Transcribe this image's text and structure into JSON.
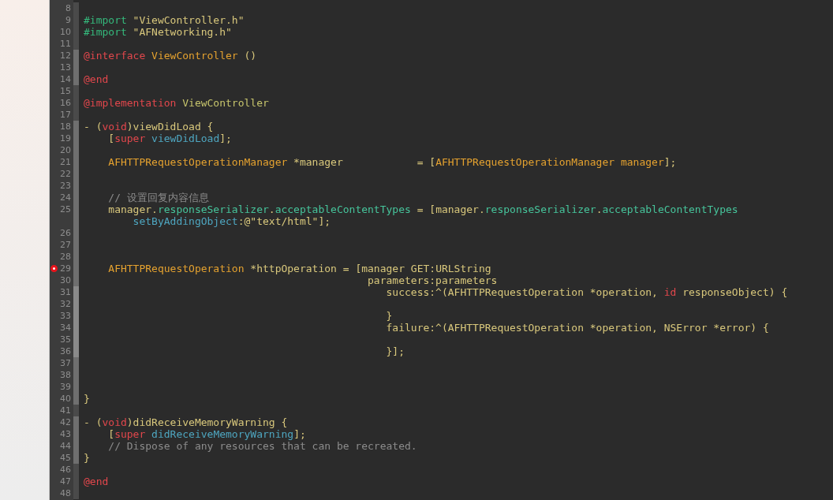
{
  "editor": {
    "lines": [
      {
        "number": "8",
        "in_block": false,
        "nested": false,
        "breakpoint": false
      },
      {
        "number": "9",
        "in_block": false,
        "nested": false,
        "breakpoint": false,
        "tokens": [
          {
            "kind": "directive",
            "text": "#import"
          },
          {
            "kind": "plain",
            "text": " \"ViewController.h\""
          }
        ]
      },
      {
        "number": "10",
        "in_block": false,
        "nested": false,
        "breakpoint": false,
        "tokens": [
          {
            "kind": "directive",
            "text": "#import"
          },
          {
            "kind": "plain",
            "text": " \"AFNetworking.h\""
          }
        ]
      },
      {
        "number": "11",
        "in_block": false,
        "nested": false,
        "breakpoint": false
      },
      {
        "number": "12",
        "in_block": true,
        "nested": false,
        "breakpoint": false,
        "tokens": [
          {
            "kind": "keyword",
            "text": "@interface "
          },
          {
            "kind": "type",
            "text": "ViewController"
          },
          {
            "kind": "plain",
            "text": " ()"
          }
        ]
      },
      {
        "number": "13",
        "in_block": true,
        "nested": false,
        "breakpoint": false
      },
      {
        "number": "14",
        "in_block": true,
        "nested": false,
        "breakpoint": false,
        "tokens": [
          {
            "kind": "keyword",
            "text": "@end"
          }
        ]
      },
      {
        "number": "15",
        "in_block": false,
        "nested": false,
        "breakpoint": false
      },
      {
        "number": "16",
        "in_block": false,
        "nested": false,
        "breakpoint": false,
        "tokens": [
          {
            "kind": "keyword",
            "text": "@implementation "
          },
          {
            "kind": "name",
            "text": "ViewController"
          }
        ]
      },
      {
        "number": "17",
        "in_block": false,
        "nested": false,
        "breakpoint": false
      },
      {
        "number": "18",
        "in_block": true,
        "nested": false,
        "breakpoint": false,
        "tokens": [
          {
            "kind": "plain",
            "text": "- ("
          },
          {
            "kind": "keyword",
            "text": "void"
          },
          {
            "kind": "plain",
            "text": ")viewDidLoad {"
          }
        ]
      },
      {
        "number": "19",
        "in_block": true,
        "nested": false,
        "breakpoint": false,
        "tokens": [
          {
            "kind": "plain",
            "text": "    ["
          },
          {
            "kind": "keyword",
            "text": "super "
          },
          {
            "kind": "method",
            "text": "viewDidLoad"
          },
          {
            "kind": "plain",
            "text": "];"
          }
        ]
      },
      {
        "number": "20",
        "in_block": true,
        "nested": false,
        "breakpoint": false
      },
      {
        "number": "21",
        "in_block": true,
        "nested": false,
        "breakpoint": false,
        "tokens": [
          {
            "kind": "type",
            "text": "    AFHTTPRequestOperationManager"
          },
          {
            "kind": "plain",
            "text": " *manager            = ["
          },
          {
            "kind": "type",
            "text": "AFHTTPRequestOperationManager manager"
          },
          {
            "kind": "plain",
            "text": "];"
          }
        ]
      },
      {
        "number": "22",
        "in_block": true,
        "nested": false,
        "breakpoint": false
      },
      {
        "number": "23",
        "in_block": true,
        "nested": false,
        "breakpoint": false
      },
      {
        "number": "24",
        "in_block": true,
        "nested": false,
        "breakpoint": false,
        "tokens": [
          {
            "kind": "comment",
            "text": "    // 设置回复内容信息"
          }
        ]
      },
      {
        "number": "25",
        "in_block": true,
        "nested": false,
        "breakpoint": false,
        "tokens": [
          {
            "kind": "plain",
            "text": "    manager."
          },
          {
            "kind": "property",
            "text": "responseSerializer"
          },
          {
            "kind": "plain",
            "text": "."
          },
          {
            "kind": "property",
            "text": "acceptableContentTypes"
          },
          {
            "kind": "plain",
            "text": " = [manager."
          },
          {
            "kind": "property",
            "text": "responseSerializer"
          },
          {
            "kind": "plain",
            "text": "."
          },
          {
            "kind": "property",
            "text": "acceptableContentTypes"
          }
        ]
      },
      {
        "in_block": true,
        "nested": false,
        "breakpoint": false,
        "tokens": [
          {
            "kind": "method",
            "text": "        setByAddingObject"
          },
          {
            "kind": "plain",
            "text": ":@\"text/html\"];"
          }
        ]
      },
      {
        "number": "26",
        "in_block": true,
        "nested": false,
        "breakpoint": false
      },
      {
        "number": "27",
        "in_block": true,
        "nested": false,
        "breakpoint": false
      },
      {
        "number": "28",
        "in_block": true,
        "nested": false,
        "breakpoint": false
      },
      {
        "number": "29",
        "in_block": true,
        "nested": false,
        "breakpoint": true,
        "tokens": [
          {
            "kind": "type",
            "text": "    AFHTTPRequestOperation"
          },
          {
            "kind": "plain",
            "text": " *httpOperation = [manager GET:URLString"
          }
        ]
      },
      {
        "number": "30",
        "in_block": true,
        "nested": false,
        "breakpoint": false,
        "tokens": [
          {
            "kind": "plain",
            "text": "                                              parameters:parameters"
          }
        ]
      },
      {
        "number": "31",
        "in_block": true,
        "nested": true,
        "breakpoint": false,
        "tokens": [
          {
            "kind": "plain",
            "text": "                                                 success:^(AFHTTPRequestOperation *operation, "
          },
          {
            "kind": "keyword",
            "text": "id"
          },
          {
            "kind": "plain",
            "text": " responseObject) {"
          }
        ]
      },
      {
        "number": "32",
        "in_block": true,
        "nested": true,
        "breakpoint": false
      },
      {
        "number": "33",
        "in_block": true,
        "nested": true,
        "breakpoint": false,
        "tokens": [
          {
            "kind": "plain",
            "text": "                                                 }"
          }
        ]
      },
      {
        "number": "34",
        "in_block": true,
        "nested": true,
        "breakpoint": false,
        "tokens": [
          {
            "kind": "plain",
            "text": "                                                 failure:^(AFHTTPRequestOperation *operation, NSError *error) {"
          }
        ]
      },
      {
        "number": "35",
        "in_block": true,
        "nested": true,
        "breakpoint": false
      },
      {
        "number": "36",
        "in_block": true,
        "nested": true,
        "breakpoint": false,
        "tokens": [
          {
            "kind": "plain",
            "text": "                                                 }];"
          }
        ]
      },
      {
        "number": "37",
        "in_block": true,
        "nested": false,
        "breakpoint": false
      },
      {
        "number": "38",
        "in_block": true,
        "nested": false,
        "breakpoint": false
      },
      {
        "number": "39",
        "in_block": true,
        "nested": false,
        "breakpoint": false
      },
      {
        "number": "40",
        "in_block": true,
        "nested": false,
        "breakpoint": false,
        "tokens": [
          {
            "kind": "plain",
            "text": "}"
          }
        ]
      },
      {
        "number": "41",
        "in_block": false,
        "nested": false,
        "breakpoint": false
      },
      {
        "number": "42",
        "in_block": true,
        "nested": false,
        "breakpoint": false,
        "tokens": [
          {
            "kind": "plain",
            "text": "- ("
          },
          {
            "kind": "keyword",
            "text": "void"
          },
          {
            "kind": "plain",
            "text": ")didReceiveMemoryWarning {"
          }
        ]
      },
      {
        "number": "43",
        "in_block": true,
        "nested": false,
        "breakpoint": false,
        "tokens": [
          {
            "kind": "plain",
            "text": "    ["
          },
          {
            "kind": "keyword",
            "text": "super "
          },
          {
            "kind": "method",
            "text": "didReceiveMemoryWarning"
          },
          {
            "kind": "plain",
            "text": "];"
          }
        ]
      },
      {
        "number": "44",
        "in_block": true,
        "nested": false,
        "breakpoint": false,
        "tokens": [
          {
            "kind": "comment",
            "text": "    // Dispose of any resources that can be recreated."
          }
        ]
      },
      {
        "number": "45",
        "in_block": true,
        "nested": false,
        "breakpoint": false,
        "tokens": [
          {
            "kind": "plain",
            "text": "}"
          }
        ]
      },
      {
        "number": "46",
        "in_block": false,
        "nested": false,
        "breakpoint": false
      },
      {
        "number": "47",
        "in_block": false,
        "nested": false,
        "breakpoint": false,
        "tokens": [
          {
            "kind": "keyword",
            "text": "@end"
          }
        ]
      },
      {
        "number": "48",
        "in_block": false,
        "nested": false,
        "breakpoint": false
      }
    ]
  }
}
